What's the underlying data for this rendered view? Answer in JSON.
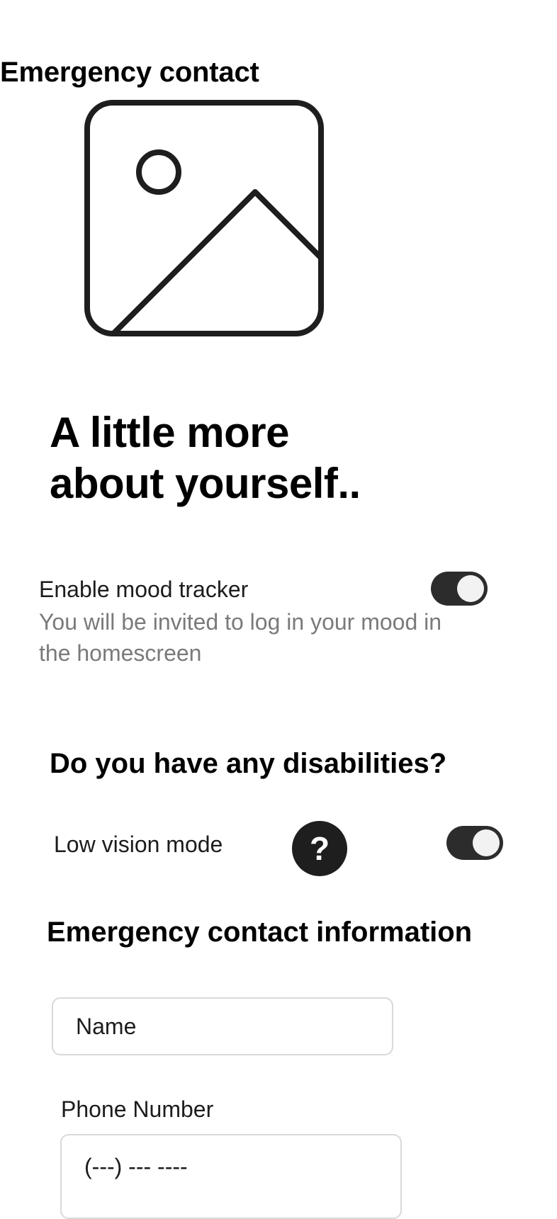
{
  "screen": {
    "title": "Emergency contact",
    "image_placeholder_icon": "image-placeholder-icon"
  },
  "intro": {
    "headline_line1": "A little more",
    "headline_line2": "about yourself.."
  },
  "mood_tracker": {
    "label": "Enable mood tracker",
    "description": "You will be invited to log in your mood in the homescreen",
    "enabled": true
  },
  "disabilities": {
    "title": "Do you have any disabilities?",
    "low_vision_label": "Low vision mode",
    "help_icon": "question-mark-icon",
    "help_glyph": "?",
    "low_vision_enabled": true
  },
  "emergency_contact": {
    "title": "Emergency contact information",
    "name_placeholder": "Name",
    "phone_label": "Phone Number",
    "phone_placeholder": "(---) --- ----"
  },
  "colors": {
    "toggle_on": "#2c2c2c",
    "help_button": "#1e1e1e",
    "description_text": "#7a7a7a",
    "field_border": "#d9d9d9"
  }
}
